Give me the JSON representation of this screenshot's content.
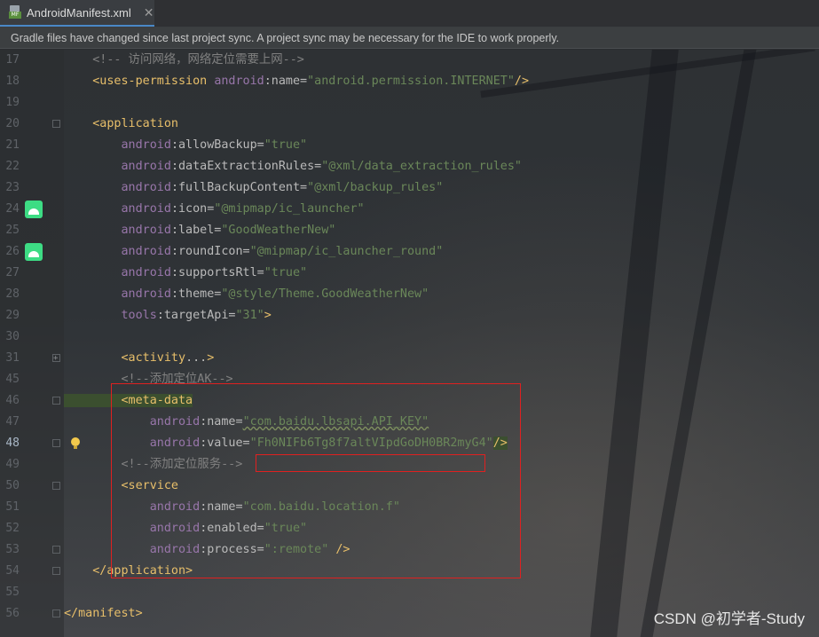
{
  "tab": {
    "title": "AndroidManifest.xml",
    "file_icon": "manifest-file-icon",
    "close_icon": "close-icon"
  },
  "banner": {
    "message": "Gradle files have changed since last project sync. A project sync may be necessary for the IDE to work properly."
  },
  "editor": {
    "lines": [
      {
        "num": "17",
        "tokens": [
          {
            "t": "    <!-- 访问网络，网络定位需要上网-->",
            "c": "cmt"
          }
        ]
      },
      {
        "num": "18",
        "tokens": [
          {
            "t": "    <uses-permission ",
            "c": "tag"
          },
          {
            "t": "android",
            "c": "ns"
          },
          {
            "t": ":name=",
            "c": "attr"
          },
          {
            "t": "\"android.permission.INTERNET\"",
            "c": "val"
          },
          {
            "t": "/>",
            "c": "tag"
          }
        ]
      },
      {
        "num": "19",
        "tokens": []
      },
      {
        "num": "20",
        "tokens": [
          {
            "t": "    <application",
            "c": "tag"
          }
        ]
      },
      {
        "num": "21",
        "tokens": [
          {
            "t": "        android",
            "c": "ns"
          },
          {
            "t": ":allowBackup=",
            "c": "attr"
          },
          {
            "t": "\"true\"",
            "c": "val"
          }
        ]
      },
      {
        "num": "22",
        "tokens": [
          {
            "t": "        android",
            "c": "ns"
          },
          {
            "t": ":dataExtractionRules=",
            "c": "attr"
          },
          {
            "t": "\"@xml/data_extraction_rules\"",
            "c": "val"
          }
        ]
      },
      {
        "num": "23",
        "tokens": [
          {
            "t": "        android",
            "c": "ns"
          },
          {
            "t": ":fullBackupContent=",
            "c": "attr"
          },
          {
            "t": "\"@xml/backup_rules\"",
            "c": "val"
          }
        ]
      },
      {
        "num": "24",
        "tokens": [
          {
            "t": "        android",
            "c": "ns"
          },
          {
            "t": ":icon=",
            "c": "attr"
          },
          {
            "t": "\"@mipmap/ic_launcher\"",
            "c": "val"
          }
        ]
      },
      {
        "num": "25",
        "tokens": [
          {
            "t": "        android",
            "c": "ns"
          },
          {
            "t": ":label=",
            "c": "attr"
          },
          {
            "t": "\"GoodWeatherNew\"",
            "c": "val"
          }
        ]
      },
      {
        "num": "26",
        "tokens": [
          {
            "t": "        android",
            "c": "ns"
          },
          {
            "t": ":roundIcon=",
            "c": "attr"
          },
          {
            "t": "\"@mipmap/ic_launcher_round\"",
            "c": "val"
          }
        ]
      },
      {
        "num": "27",
        "tokens": [
          {
            "t": "        android",
            "c": "ns"
          },
          {
            "t": ":supportsRtl=",
            "c": "attr"
          },
          {
            "t": "\"true\"",
            "c": "val"
          }
        ]
      },
      {
        "num": "28",
        "tokens": [
          {
            "t": "        android",
            "c": "ns"
          },
          {
            "t": ":theme=",
            "c": "attr"
          },
          {
            "t": "\"@style/Theme.GoodWeatherNew\"",
            "c": "val"
          }
        ]
      },
      {
        "num": "29",
        "tokens": [
          {
            "t": "        tools",
            "c": "ns"
          },
          {
            "t": ":targetApi=",
            "c": "attr"
          },
          {
            "t": "\"31\"",
            "c": "val"
          },
          {
            "t": ">",
            "c": "tag"
          }
        ]
      },
      {
        "num": "30",
        "tokens": []
      },
      {
        "num": "31",
        "tokens": [
          {
            "t": "        <activity",
            "c": "tag"
          },
          {
            "t": "...",
            "c": "attr"
          },
          {
            "t": ">",
            "c": "tag"
          }
        ]
      },
      {
        "num": "45",
        "tokens": [
          {
            "t": "        <!--添加定位AK-->",
            "c": "cmt"
          }
        ]
      },
      {
        "num": "46",
        "tokens": [
          {
            "t": "        <meta-data",
            "c": "tag"
          }
        ]
      },
      {
        "num": "47",
        "tokens": [
          {
            "t": "            android",
            "c": "ns"
          },
          {
            "t": ":name=",
            "c": "attr"
          },
          {
            "t": "\"com.baidu.lbsapi.API_KEY\"",
            "c": "val"
          }
        ]
      },
      {
        "num": "48",
        "tokens": [
          {
            "t": "            android",
            "c": "ns"
          },
          {
            "t": ":value=",
            "c": "attr"
          },
          {
            "t": "\"",
            "c": "val"
          },
          {
            "t": "Fh0NIFb6Tg8f7altVIpdGoDH0BR2myG4",
            "c": "val"
          },
          {
            "t": "\"",
            "c": "val"
          },
          {
            "t": "/>",
            "c": "tag"
          }
        ]
      },
      {
        "num": "49",
        "tokens": [
          {
            "t": "        <!--添加定位服务-->",
            "c": "cmt"
          }
        ]
      },
      {
        "num": "50",
        "tokens": [
          {
            "t": "        <service",
            "c": "tag"
          }
        ]
      },
      {
        "num": "51",
        "tokens": [
          {
            "t": "            android",
            "c": "ns"
          },
          {
            "t": ":name=",
            "c": "attr"
          },
          {
            "t": "\"com.baidu.location.f\"",
            "c": "val"
          }
        ]
      },
      {
        "num": "52",
        "tokens": [
          {
            "t": "            android",
            "c": "ns"
          },
          {
            "t": ":enabled=",
            "c": "attr"
          },
          {
            "t": "\"true\"",
            "c": "val"
          }
        ]
      },
      {
        "num": "53",
        "tokens": [
          {
            "t": "            android",
            "c": "ns"
          },
          {
            "t": ":process=",
            "c": "attr"
          },
          {
            "t": "\":remote\"",
            "c": "val"
          },
          {
            "t": " />",
            "c": "tag"
          }
        ]
      },
      {
        "num": "54",
        "tokens": [
          {
            "t": "    </application>",
            "c": "tag"
          }
        ]
      },
      {
        "num": "55",
        "tokens": []
      },
      {
        "num": "56",
        "tokens": [
          {
            "t": "</manifest>",
            "c": "tag"
          }
        ]
      }
    ],
    "current_line": "48",
    "gutter_icons": {
      "24": "android-icon",
      "26": "android-icon",
      "48": "lightbulb-icon"
    }
  },
  "watermark": "CSDN @初学者-Study"
}
